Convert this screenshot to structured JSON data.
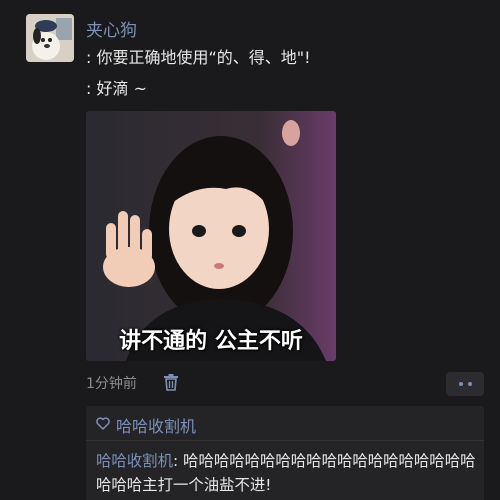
{
  "post": {
    "author": "夹心狗",
    "lines": [
      ": 你要正确地使用“的、得、地\"!",
      ": 好滴 ~"
    ],
    "image": {
      "caption": "讲不通的 公主不听"
    },
    "time": "1分钟前",
    "icons": {
      "delete": "trash-icon",
      "more": "more-dots-icon",
      "like": "heart-icon"
    }
  },
  "likes": {
    "names": "哈哈收割机"
  },
  "comments": [
    {
      "author": "哈哈收割机",
      "separator": ": ",
      "text": "哈哈哈哈哈哈哈哈哈哈哈哈哈哈哈哈哈哈哈哈哈哈主打一个油盐不进!"
    }
  ],
  "colors": {
    "background": "#1a1a1c",
    "name_link": "#7d8fb7",
    "panel": "#242427"
  }
}
